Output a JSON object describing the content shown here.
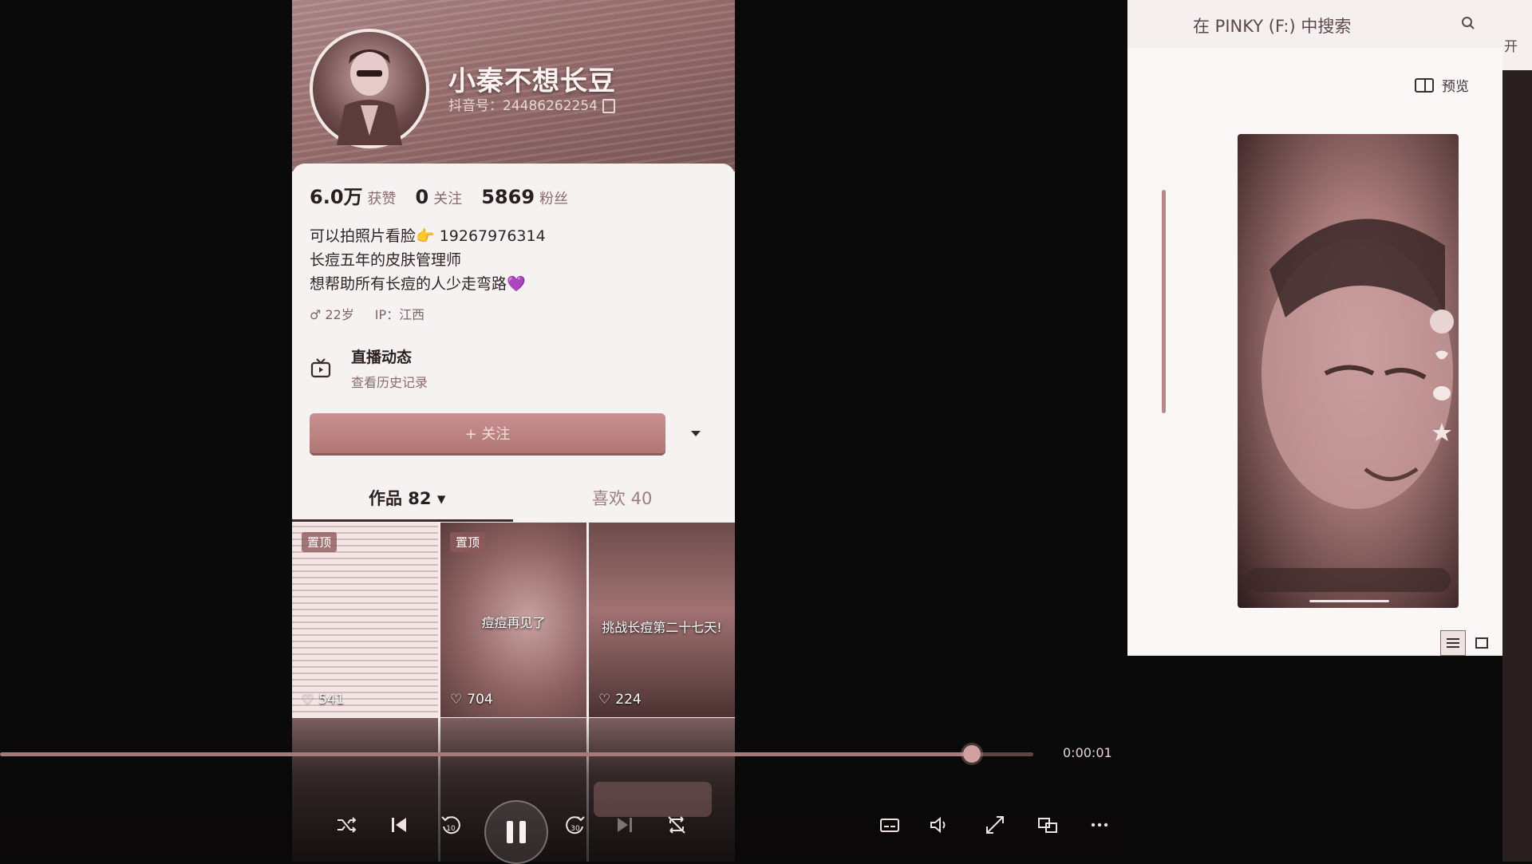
{
  "profile": {
    "nickname": "小秦不想长豆",
    "douyin_id": "抖音号：24486262254",
    "stats": [
      {
        "value": "6.0万",
        "label": "获赞"
      },
      {
        "value": "0",
        "label": "关注"
      },
      {
        "value": "5869",
        "label": "粉丝"
      }
    ],
    "bio_lines": [
      "可以拍照片看脸👉 19267976314",
      "长痘五年的皮肤管理师",
      "想帮助所有长痘的人少走弯路💜"
    ],
    "meta": {
      "age": "♂ 22岁",
      "ip": "IP：江西"
    },
    "live": {
      "title": "直播动态",
      "subtitle": "查看历史记录"
    },
    "follow_label": "+ 关注",
    "tabs": [
      {
        "label": "作品 82 ▾"
      },
      {
        "label": "喜欢 40"
      }
    ],
    "videos": [
      {
        "pin": "置顶",
        "likes": "541",
        "caption": ""
      },
      {
        "pin": "置顶",
        "likes": "704",
        "caption": "痘痘再见了"
      },
      {
        "pin": "",
        "likes": "224",
        "caption": "挑战长痘第二十七天!"
      }
    ]
  },
  "player": {
    "time": "0:00:01",
    "progress": 0.94,
    "icons": [
      "shuffle-icon",
      "previous-icon",
      "rewind-10-icon",
      "pause-icon",
      "forward-30-icon",
      "next-icon",
      "repeat-off-icon",
      "subtitles-icon",
      "volume-icon",
      "fullscreen-icon",
      "miniplayer-icon",
      "more-icon"
    ]
  },
  "explorer": {
    "search_placeholder": "在 PINKY (F:) 中搜索",
    "preview_label": "预览",
    "edge_text": "开"
  },
  "colors": {
    "accent": "#b07676",
    "background": "#0b0a0a",
    "panel": "#f6efef"
  }
}
